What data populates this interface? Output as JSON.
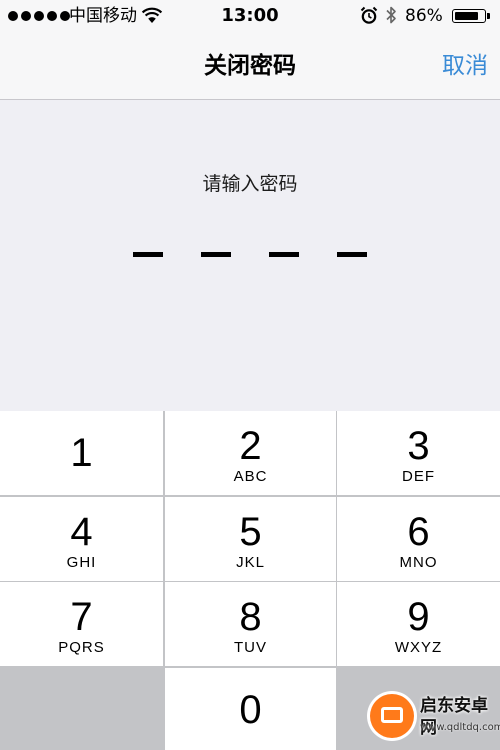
{
  "status_bar": {
    "carrier": "中国移动",
    "time": "13:00",
    "battery_percent": "86%",
    "battery_level": 0.86,
    "signal_bars": 5,
    "icons": [
      "wifi-icon",
      "alarm-icon",
      "bluetooth-icon",
      "battery-icon"
    ]
  },
  "nav": {
    "title": "关闭密码",
    "cancel": "取消"
  },
  "passcode": {
    "prompt": "请输入密码",
    "length": 4,
    "entered": 0
  },
  "keypad": {
    "keys": [
      {
        "num": "1",
        "letters": ""
      },
      {
        "num": "2",
        "letters": "ABC"
      },
      {
        "num": "3",
        "letters": "DEF"
      },
      {
        "num": "4",
        "letters": "GHI"
      },
      {
        "num": "5",
        "letters": "JKL"
      },
      {
        "num": "6",
        "letters": "MNO"
      },
      {
        "num": "7",
        "letters": "PQRS"
      },
      {
        "num": "8",
        "letters": "TUV"
      },
      {
        "num": "9",
        "letters": "WXYZ"
      },
      {
        "num": "0",
        "letters": ""
      }
    ]
  },
  "watermark": {
    "name": "启东安卓网",
    "url": "www.qdltdq.com"
  },
  "colors": {
    "accent": "#3a8bd6",
    "background": "#efeff4",
    "keypad_gap": "#c3c4c7"
  }
}
